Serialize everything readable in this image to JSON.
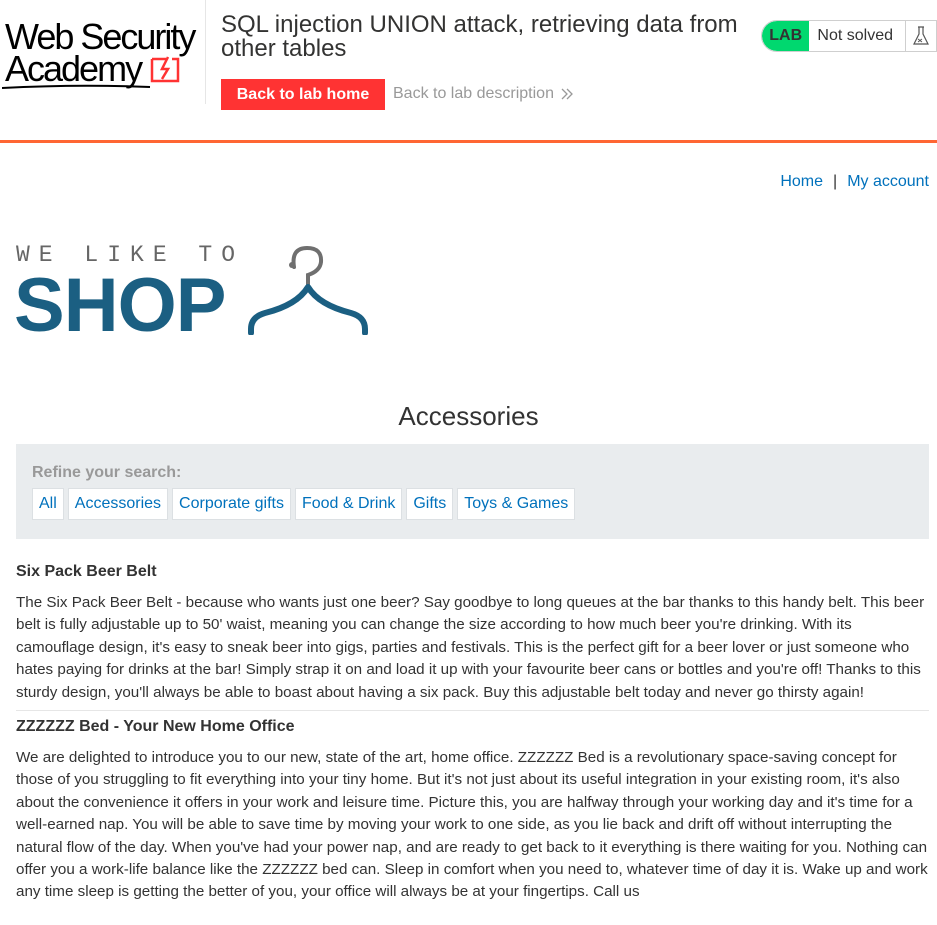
{
  "academy": {
    "logo_line1": "Web Security",
    "logo_line2": "Academy",
    "lab_title": "SQL injection UNION attack, retrieving data from other tables",
    "back_to_lab_home": "Back to lab home",
    "back_to_lab_description": "Back to lab description",
    "status_badge": "LAB",
    "status_text": "Not solved",
    "colors": {
      "accent": "#ff6633",
      "button": "#ff3333",
      "lab_badge": "#00d86f"
    }
  },
  "nav": {
    "home": "Home",
    "separator": "|",
    "my_account": "My account"
  },
  "shop_logo": {
    "top_text": "WE LIKE TO",
    "main_text": "SHOP",
    "color": "#1b5f82"
  },
  "page": {
    "heading": "Accessories"
  },
  "filter": {
    "label": "Refine your search:",
    "categories": [
      "All",
      "Accessories",
      "Corporate gifts",
      "Food & Drink",
      "Gifts",
      "Toys & Games"
    ]
  },
  "products": [
    {
      "name": "Six Pack Beer Belt",
      "description": "The Six Pack Beer Belt - because who wants just one beer? Say goodbye to long queues at the bar thanks to this handy belt. This beer belt is fully adjustable up to 50' waist, meaning you can change the size according to how much beer you're drinking. With its camouflage design, it's easy to sneak beer into gigs, parties and festivals. This is the perfect gift for a beer lover or just someone who hates paying for drinks at the bar! Simply strap it on and load it up with your favourite beer cans or bottles and you're off! Thanks to this sturdy design, you'll always be able to boast about having a six pack. Buy this adjustable belt today and never go thirsty again!"
    },
    {
      "name": "ZZZZZZ Bed - Your New Home Office",
      "description": "We are delighted to introduce you to our new, state of the art, home office. ZZZZZZ Bed is a revolutionary space-saving concept for those of you struggling to fit everything into your tiny home. But it's not just about its useful integration in your existing room, it's also about the convenience it offers in your work and leisure time. Picture this, you are halfway through your working day and it's time for a well-earned nap. You will be able to save time by moving your work to one side, as you lie back and drift off without interrupting the natural flow of the day. When you've had your power nap, and are ready to get back to it everything is there waiting for you. Nothing can offer you a work-life balance like the ZZZZZZ bed can. Sleep in comfort when you need to, whatever time of day it is. Wake up and work any time sleep is getting the better of you, your office will always be at your fingertips. Call us"
    }
  ]
}
